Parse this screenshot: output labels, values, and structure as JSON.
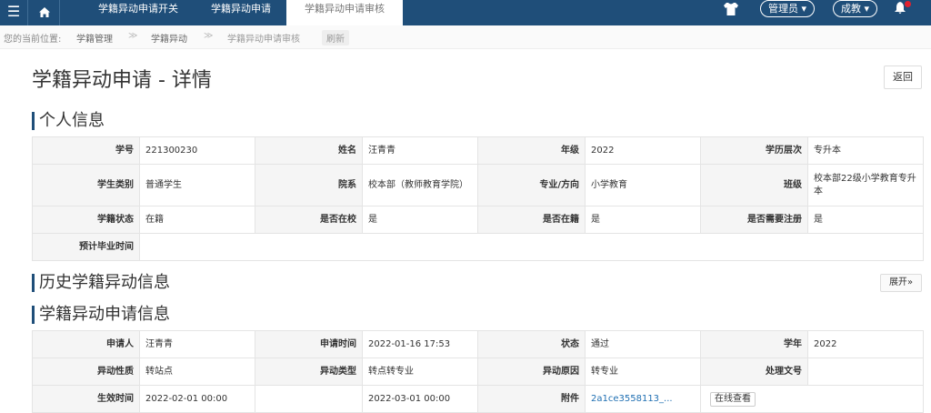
{
  "topbar": {
    "menu_icon": "☰",
    "tabs": [
      "学籍异动申请开关",
      "学籍异动申请",
      "学籍异动申请审核"
    ],
    "admin_label": "管理员",
    "role_label": "成教",
    "caret": "▾"
  },
  "breadcrumb": {
    "prefix": "您的当前位置:",
    "items": [
      "学籍管理",
      "学籍异动",
      "学籍异动申请审核"
    ],
    "separator": "≫",
    "refresh": "刷新"
  },
  "page": {
    "title": "学籍异动申请 - 详情",
    "back_button": "返回"
  },
  "personal": {
    "title": "个人信息",
    "rows": [
      [
        [
          "学号",
          "221300230"
        ],
        [
          "姓名",
          "汪青青"
        ],
        [
          "年级",
          "2022"
        ],
        [
          "学历层次",
          "专升本"
        ]
      ],
      [
        [
          "学生类别",
          "普通学生"
        ],
        [
          "院系",
          "校本部（教师教育学院）"
        ],
        [
          "专业/方向",
          "小学教育"
        ],
        [
          "班级",
          "校本部22级小学教育专升本"
        ]
      ],
      [
        [
          "学籍状态",
          "在籍"
        ],
        [
          "是否在校",
          "是"
        ],
        [
          "是否在籍",
          "是"
        ],
        [
          "是否需要注册",
          "是"
        ]
      ],
      [
        [
          "预计毕业时间",
          ""
        ]
      ]
    ]
  },
  "history": {
    "title": "历史学籍异动信息",
    "expand_button": "展开"
  },
  "apply": {
    "title": "学籍异动申请信息",
    "rows": [
      [
        [
          "申请人",
          "汪青青"
        ],
        [
          "申请时间",
          "2022-01-16 17:53"
        ],
        [
          "状态",
          "通过"
        ],
        [
          "学年",
          "2022"
        ]
      ],
      [
        [
          "异动性质",
          "转站点"
        ],
        [
          "异动类型",
          "转点转专业"
        ],
        [
          "异动原因",
          "转专业"
        ],
        [
          "处理文号",
          ""
        ]
      ],
      [
        [
          "生效时间",
          "2022-02-01 00:00"
        ],
        [
          "",
          "2022-03-01 00:00"
        ],
        [
          "附件",
          "2a1ce3558113_..."
        ],
        [
          "",
          ""
        ]
      ]
    ],
    "preview_button": "在线查看"
  },
  "colors": {
    "nav": "#1f4e79",
    "label_bg": "#f5f5f5",
    "border": "#e4e4e4",
    "notify": "#e0212f"
  }
}
